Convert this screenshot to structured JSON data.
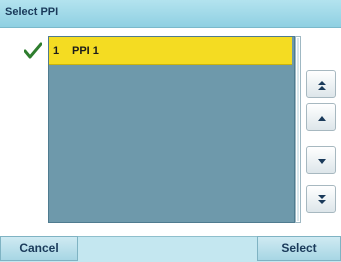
{
  "header": {
    "title": "Select PPI"
  },
  "list": {
    "items": [
      {
        "number": "1",
        "name": "PPI 1",
        "selected": true
      }
    ]
  },
  "scroll_controls": {
    "buttons": [
      "scroll-to-top",
      "scroll-up",
      "scroll-down",
      "scroll-to-bottom"
    ]
  },
  "footer": {
    "cancel_label": "Cancel",
    "select_label": "Select"
  },
  "colors": {
    "titlebar": "#9fd9ea",
    "selection": "#f4dc22",
    "list_background": "#6e99ab",
    "checkmark": "#2e7d2e"
  }
}
